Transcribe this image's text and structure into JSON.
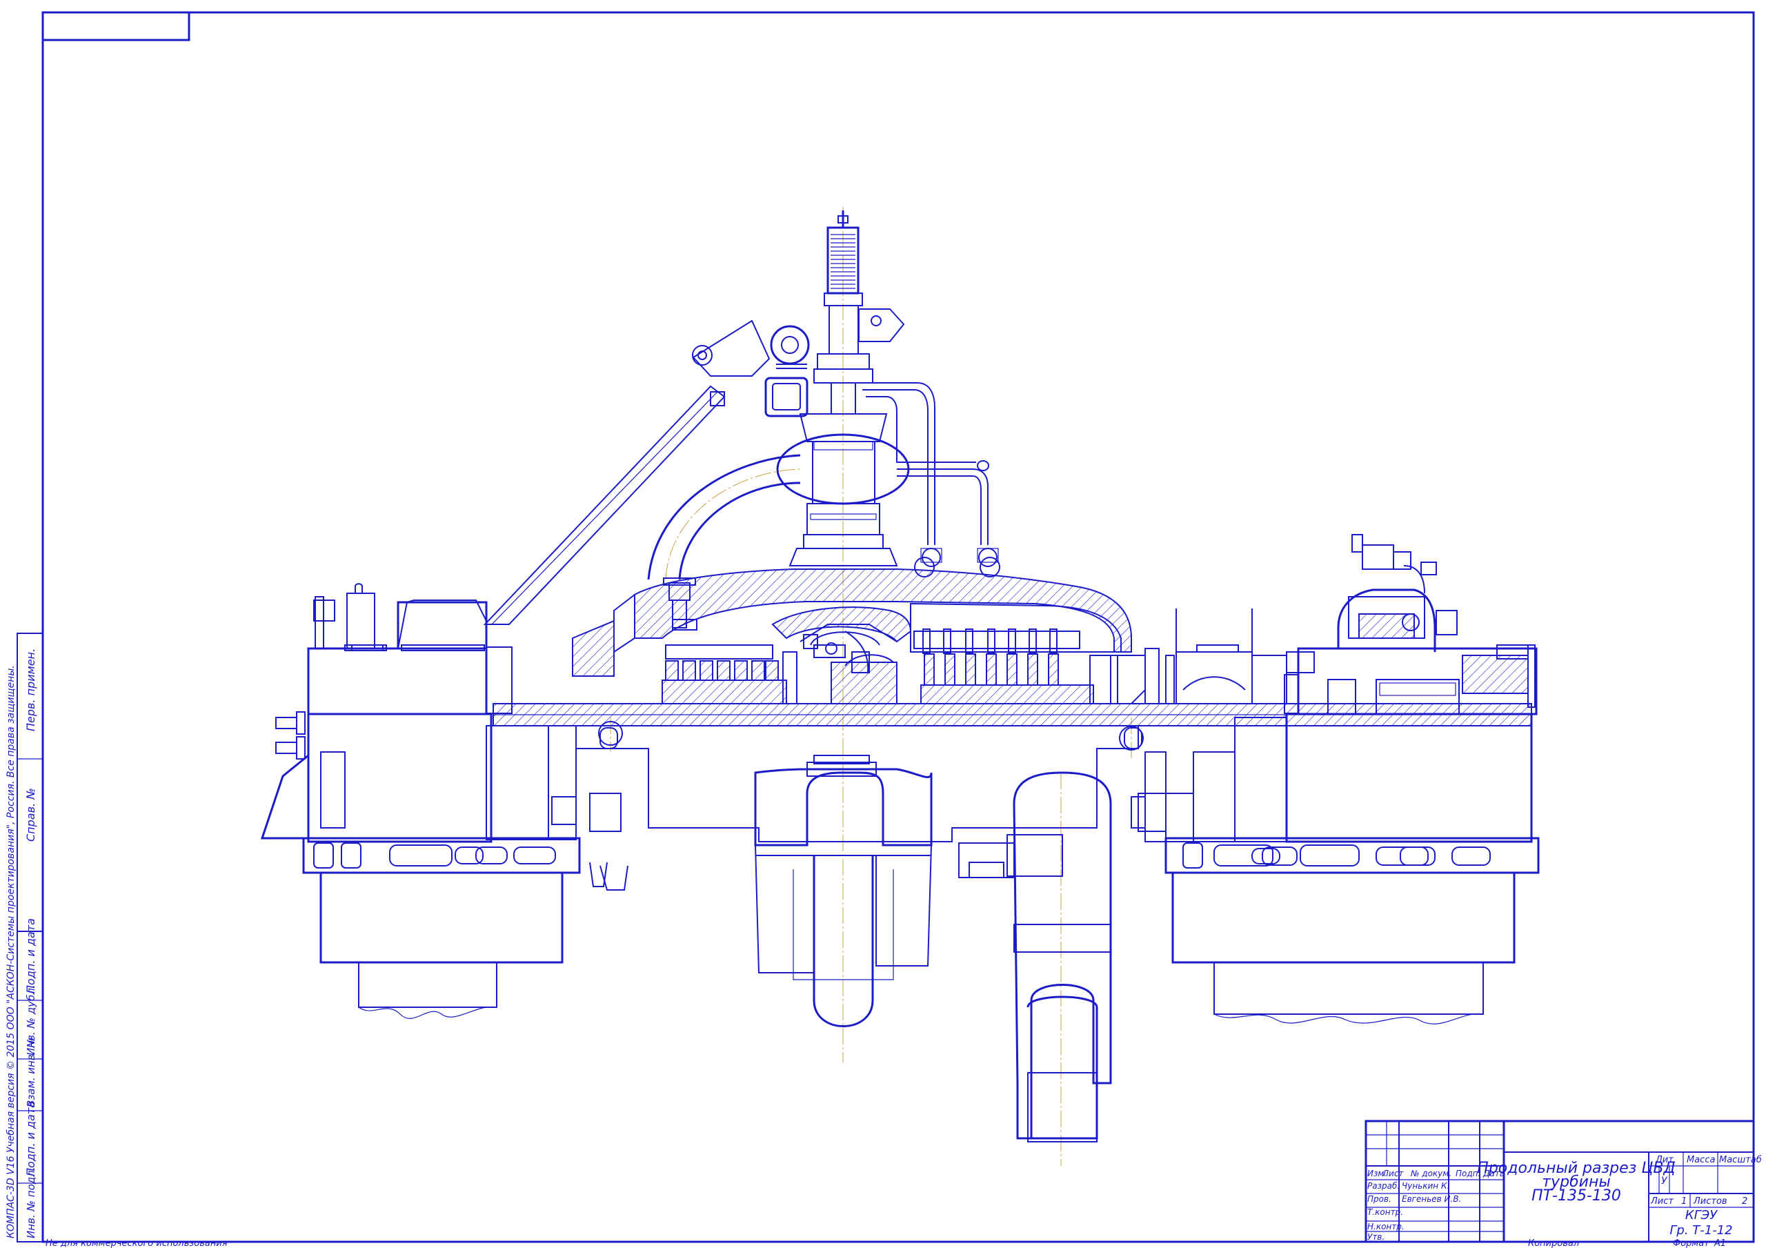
{
  "title_block": {
    "title_line1": "Продольный разрез ЦВД",
    "title_line2": "турбины",
    "title_line3": "ПТ-135-130",
    "headers": {
      "izm": "Изм.",
      "list": "Лист",
      "doc_no": "№ докум.",
      "sign": "Подп.",
      "date": "Дата"
    },
    "roles": {
      "developer": "Разраб.",
      "checker": "Пров.",
      "tech_control": "Т.контр.",
      "norm_control": "Н.контр.",
      "approved": "Утв."
    },
    "developer_name": "Чунькин К.",
    "checker_name": "Евгеньев И.В.",
    "lit_label": "Лит.",
    "mass_label": "Масса",
    "scale_label": "Масштаб",
    "lit_value": "У",
    "sheet_label": "Лист",
    "sheet_value": "1",
    "sheets_label": "Листов",
    "sheets_value": "2",
    "org_line1": "КГЭУ",
    "org_line2": "Гр. Т-1-12"
  },
  "footer": {
    "noncommercial": "Не для коммерческого использования",
    "copied": "Копировал",
    "format_label": "Формат",
    "format_value": "A1"
  },
  "side_stamp": {
    "copyright": "КОМПАС-3D V16 Учебная версия © 2015 ООО \"АСКОН-Системы проектирования\", Россия. Все права защищены.",
    "perv_primen": "Перв. примен.",
    "sprav_no": "Справ. №",
    "podp_data_1": "Подп. и дата",
    "inv_dubl": "Инв. № дубл.",
    "vzam_inv": "Взам. инв. №",
    "podp_data_2": "Подп. и дата",
    "inv_podl": "Инв. № подл."
  },
  "colors": {
    "line": "#1b1bc8",
    "axis": "#c8a040",
    "paper": "#ffffff"
  }
}
